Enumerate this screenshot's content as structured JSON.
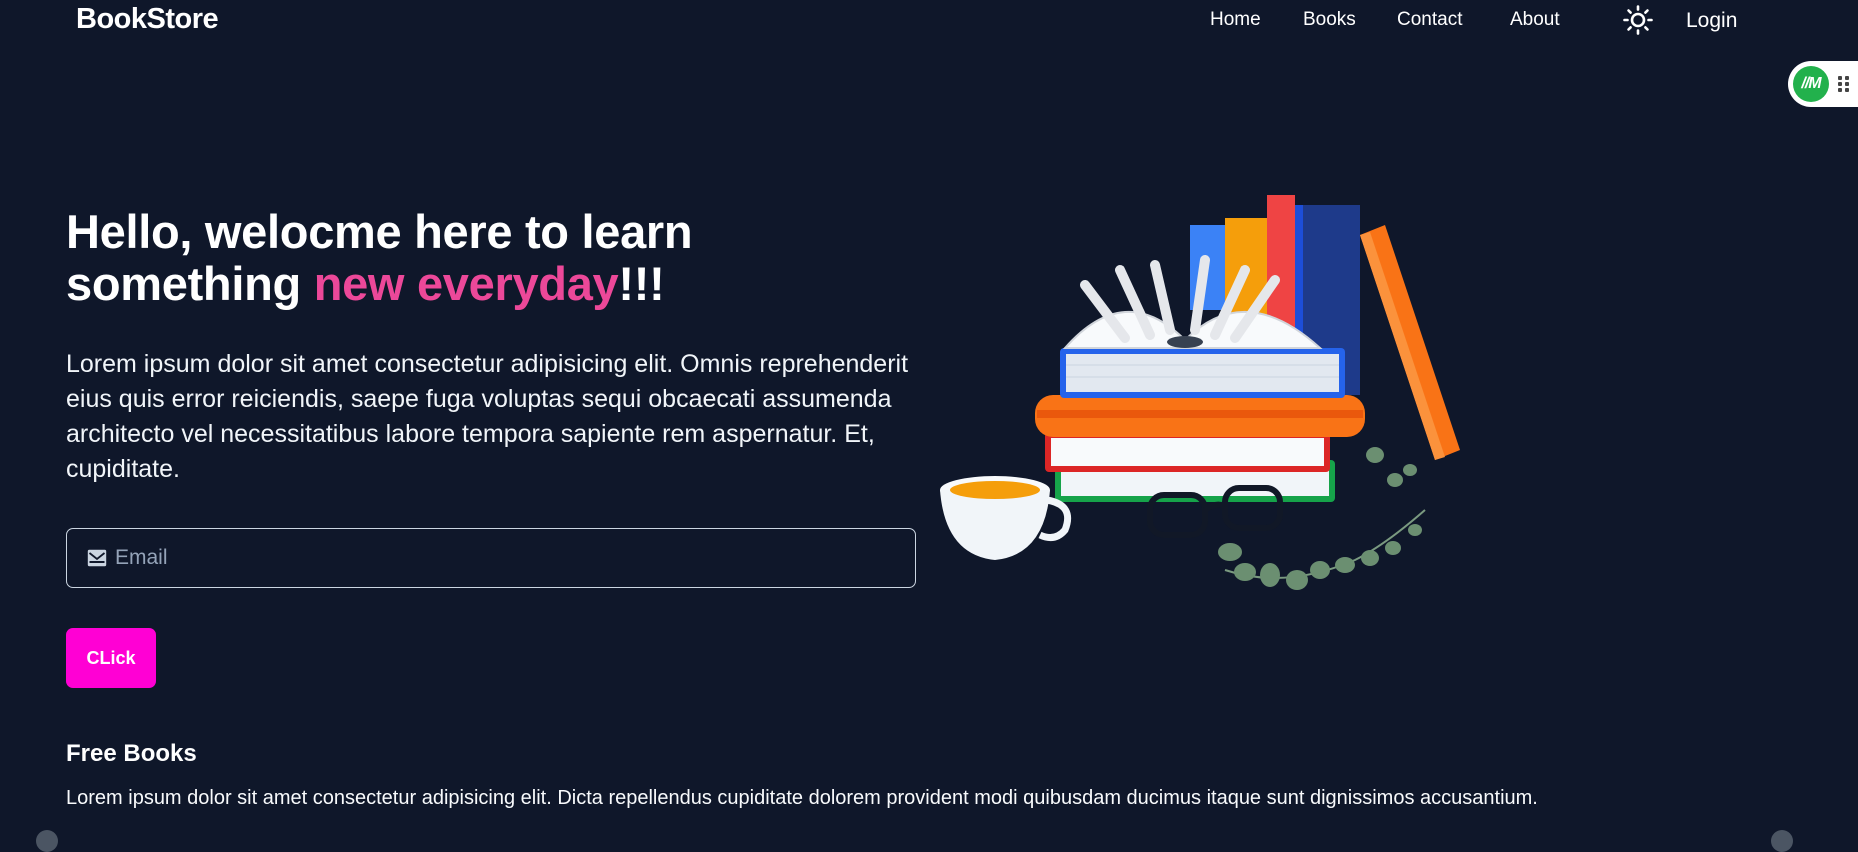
{
  "brand": "BookStore",
  "nav": {
    "home": "Home",
    "books": "Books",
    "contact": "Contact",
    "about": "About",
    "login": "Login",
    "theme_icon": "sun-icon"
  },
  "extension": {
    "badge": "//M",
    "icon": "drag-grip-icon"
  },
  "hero": {
    "title_part1": "Hello, welocme here to learn something ",
    "title_accent": "new everyday",
    "title_part2": "!!!",
    "description": "Lorem ipsum dolor sit amet consectetur adipisicing elit. Omnis reprehenderit eius quis error reiciendis, saepe fuga voluptas sequi obcaecati assumenda architecto vel necessitatibus labore tempora sapiente rem aspernatur. Et, cupiditate.",
    "email_placeholder": "Email",
    "email_value": "",
    "email_icon": "mail-icon",
    "button_label": "CLick"
  },
  "free_books": {
    "title": "Free Books",
    "description": "Lorem ipsum dolor sit amet consectetur adipisicing elit. Dicta repellendus cupiditate dolorem provident modi quibusdam ducimus itaque sunt dignissimos accusantium."
  },
  "colors": {
    "background": "#0f172a",
    "accent_pink": "#ec4899",
    "button_magenta": "#ff00d4",
    "text": "#ffffff"
  }
}
